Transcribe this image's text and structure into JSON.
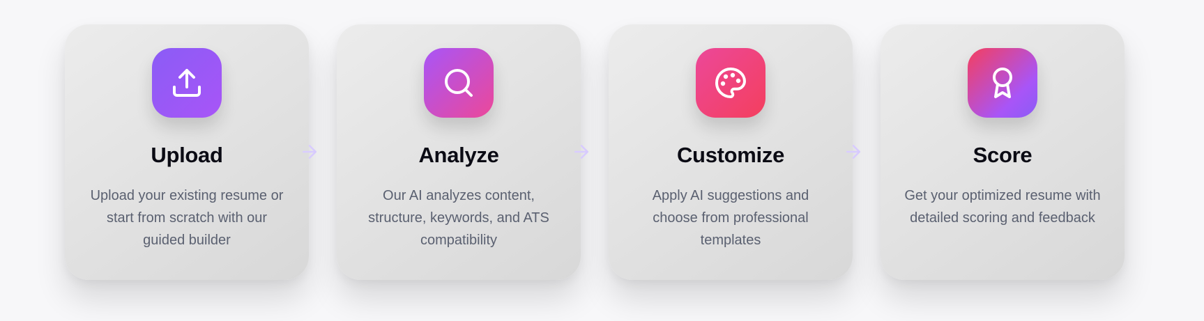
{
  "steps": [
    {
      "title": "Upload",
      "description": "Upload your existing resume or start from scratch with our guided builder",
      "icon": "upload-icon",
      "gradient": [
        "#8b5cf6",
        "#a855f7"
      ]
    },
    {
      "title": "Analyze",
      "description": "Our AI analyzes content, structure, keywords, and ATS compatibility",
      "icon": "search-icon",
      "gradient": [
        "#a855f7",
        "#ec4899"
      ]
    },
    {
      "title": "Customize",
      "description": "Apply AI suggestions and choose from professional templates",
      "icon": "palette-icon",
      "gradient": [
        "#ec4899",
        "#f43f5e"
      ]
    },
    {
      "title": "Score",
      "description": "Get your optimized resume with detailed scoring and feedback",
      "icon": "award-icon",
      "gradient": [
        "#f43f5e",
        "#8b5cf6"
      ]
    }
  ],
  "connector_icon": "arrow-right-icon",
  "colors": {
    "background": "#f7f7f9",
    "title": "#0b0b14",
    "description": "#5a6070",
    "arrow": "#d9ccff"
  }
}
